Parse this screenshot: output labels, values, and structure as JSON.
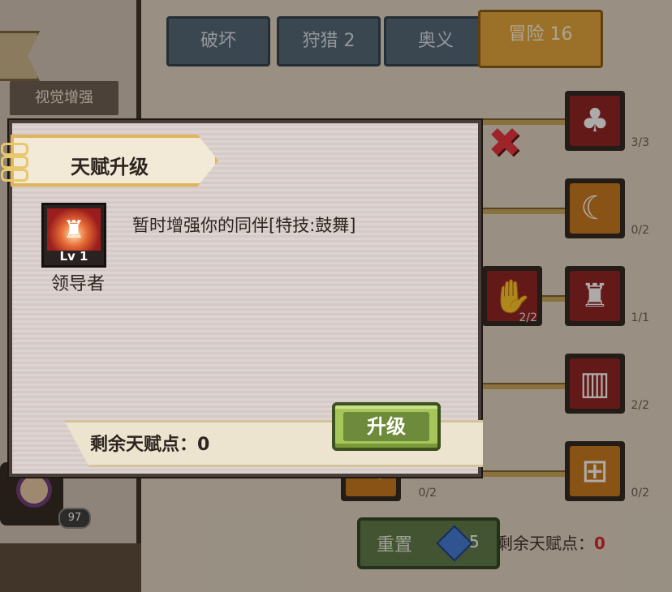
{
  "tabs": [
    {
      "label": "破坏"
    },
    {
      "label": "狩猎 2"
    },
    {
      "label": "奥义"
    },
    {
      "label": "冒险 16"
    }
  ],
  "left_panel": {
    "tag": "视觉增强",
    "avatar_count": "97"
  },
  "tree_nodes": [
    {
      "icon": "clover-icon",
      "glyph": "♣",
      "count": "3/3"
    },
    {
      "icon": "crescent-icon",
      "glyph": "☾",
      "count": "0/2"
    },
    {
      "icon": "handshake-icon",
      "glyph": "✋",
      "count": "2/2"
    },
    {
      "icon": "leader-icon",
      "glyph": "♜",
      "count": "1/1"
    },
    {
      "icon": "crate-icon",
      "glyph": "▥",
      "count": "2/2"
    },
    {
      "icon": "calculator-icon",
      "glyph": "⊞",
      "count": "0/2"
    },
    {
      "icon": "scroll-icon",
      "glyph": "✎",
      "count": "0/2"
    }
  ],
  "reset": {
    "label": "重置",
    "cost": "5"
  },
  "bottom_points": {
    "label": "剩余天赋点：",
    "value": "0"
  },
  "dialog": {
    "title": "天赋升级",
    "skill_level": "Lv 1",
    "skill_name": "领导者",
    "description": "暂时增强你的同伴[特技:鼓舞]",
    "points_label": "剩余天赋点：0",
    "upgrade_label": "升级"
  }
}
